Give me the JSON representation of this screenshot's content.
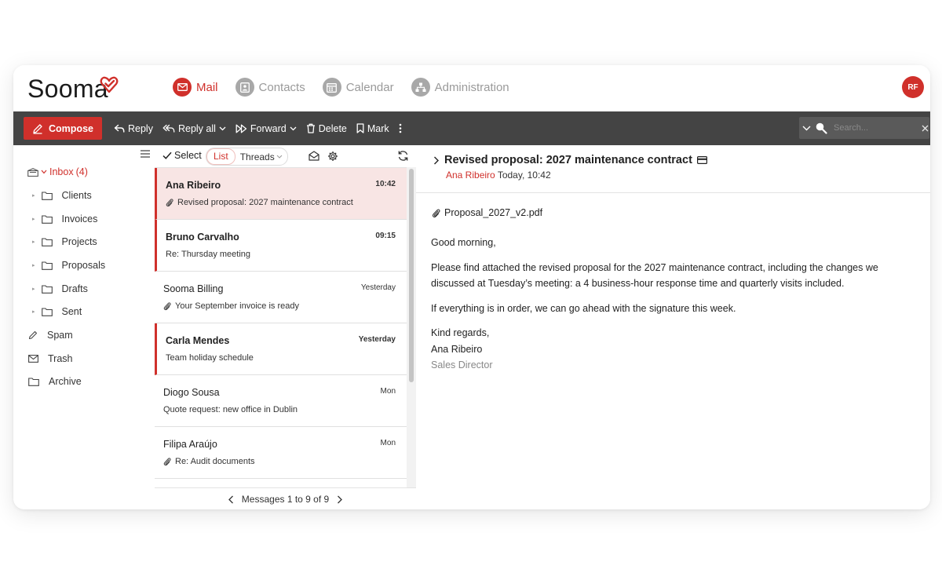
{
  "app": {
    "brand": "Sooma",
    "avatar_initials": "RF"
  },
  "nav": {
    "mail": "Mail",
    "contacts": "Contacts",
    "calendar": "Calendar",
    "administration": "Administration"
  },
  "toolbar": {
    "compose": "Compose",
    "reply": "Reply",
    "reply_all": "Reply all",
    "forward": "Forward",
    "delete": "Delete",
    "mark": "Mark",
    "search_placeholder": "Search..."
  },
  "folders": {
    "inbox": "Inbox",
    "inbox_count": "(4)",
    "clients": "Clients",
    "invoices": "Invoices",
    "projects": "Projects",
    "proposals": "Proposals",
    "drafts": "Drafts",
    "sent": "Sent",
    "spam": "Spam",
    "trash": "Trash",
    "archive": "Archive"
  },
  "list": {
    "select": "Select",
    "view_list": "List",
    "view_threads": "Threads",
    "pager": "Messages 1 to 9 of 9",
    "messages": [
      {
        "from": "Ana Ribeiro",
        "time": "10:42",
        "subject": "Revised proposal: 2027 maintenance contract",
        "attachment": true,
        "unread": true,
        "selected": true
      },
      {
        "from": "Bruno Carvalho",
        "time": "09:15",
        "subject": "Re: Thursday meeting",
        "attachment": false,
        "unread": true,
        "selected": false
      },
      {
        "from": "Sooma Billing",
        "time": "Yesterday",
        "subject": "Your September invoice is ready",
        "attachment": true,
        "unread": false,
        "selected": false
      },
      {
        "from": "Carla Mendes",
        "time": "Yesterday",
        "subject": "Team holiday schedule",
        "attachment": false,
        "unread": true,
        "selected": false
      },
      {
        "from": "Diogo Sousa",
        "time": "Mon",
        "subject": "Quote request: new office in Dublin",
        "attachment": false,
        "unread": false,
        "selected": false
      },
      {
        "from": "Filipa Araújo",
        "time": "Mon",
        "subject": "Re: Audit documents",
        "attachment": true,
        "unread": false,
        "selected": false
      }
    ]
  },
  "reader": {
    "subject": "Revised proposal: 2027 maintenance contract",
    "sender": "Ana Ribeiro",
    "date": "Today, 10:42",
    "attachment": "Proposal_2027_v2.pdf",
    "greeting": "Good morning,",
    "para1": "Please find attached the revised proposal for the 2027 maintenance contract, including the changes we discussed at Tuesday’s meeting: a 4 business-hour response time and quarterly visits included.",
    "para2": "If everything is in order, we can go ahead with the signature this week.",
    "closing": "Kind regards,",
    "signature_name": "Ana Ribeiro",
    "signature_title": "Sales Director"
  },
  "colors": {
    "accent": "#d0302b",
    "toolbar": "#444444",
    "selected_row": "#f8e5e4"
  }
}
